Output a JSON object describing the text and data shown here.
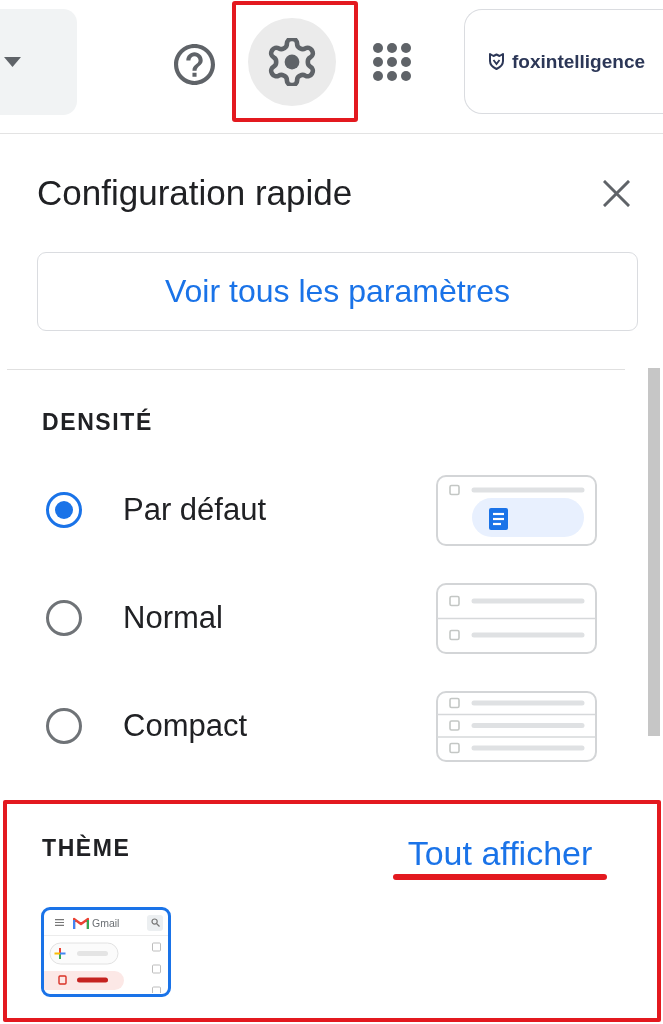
{
  "toolbar": {
    "settings": {
      "active": true,
      "highlighted": true
    },
    "account": {
      "label": "foxintelligence"
    }
  },
  "quick_settings": {
    "title": "Configuration rapide",
    "all_settings_button": "Voir tous les paramètres",
    "density": {
      "heading": "DENSITÉ",
      "options": [
        {
          "label": "Par défaut",
          "kind": "default",
          "selected": true
        },
        {
          "label": "Normal",
          "kind": "normal",
          "selected": false
        },
        {
          "label": "Compact",
          "kind": "compact",
          "selected": false
        }
      ]
    },
    "theme": {
      "heading": "THÈME",
      "link": "Tout afficher",
      "highlighted": true,
      "link_underlined": true,
      "thumbnails": [
        {
          "app_name": "Gmail",
          "selected": true
        }
      ]
    }
  }
}
